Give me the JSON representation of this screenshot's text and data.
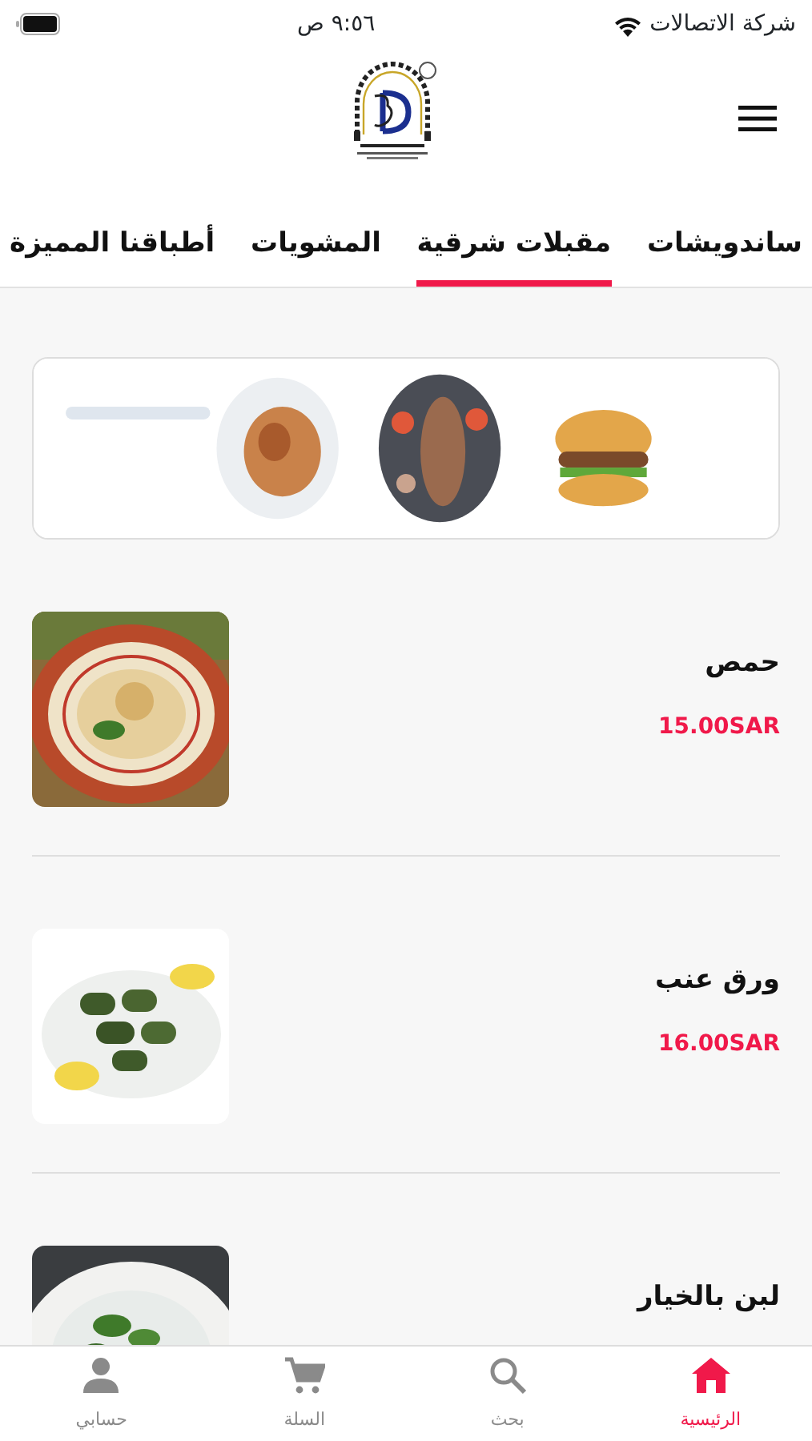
{
  "status_bar": {
    "carrier": "شركة الاتصالات",
    "time": "٩:٥٦ ص"
  },
  "tabs": [
    {
      "label": "ساندويشات",
      "selected": false
    },
    {
      "label": "مقبلات شرقية",
      "selected": true
    },
    {
      "label": "المشويات",
      "selected": false
    },
    {
      "label": "أطباقنا المميزة",
      "selected": false
    }
  ],
  "items": [
    {
      "name": "حمص",
      "price": "15.00SAR"
    },
    {
      "name": "ورق عنب",
      "price": "16.00SAR"
    },
    {
      "name": "لبن بالخيار"
    }
  ],
  "bottom_nav": [
    {
      "kind": "home",
      "label": "الرئيسية",
      "selected": true
    },
    {
      "kind": "search",
      "label": "بحث",
      "selected": false
    },
    {
      "kind": "cart",
      "label": "السلة",
      "selected": false
    },
    {
      "kind": "account",
      "label": "حسابي",
      "selected": false
    }
  ]
}
